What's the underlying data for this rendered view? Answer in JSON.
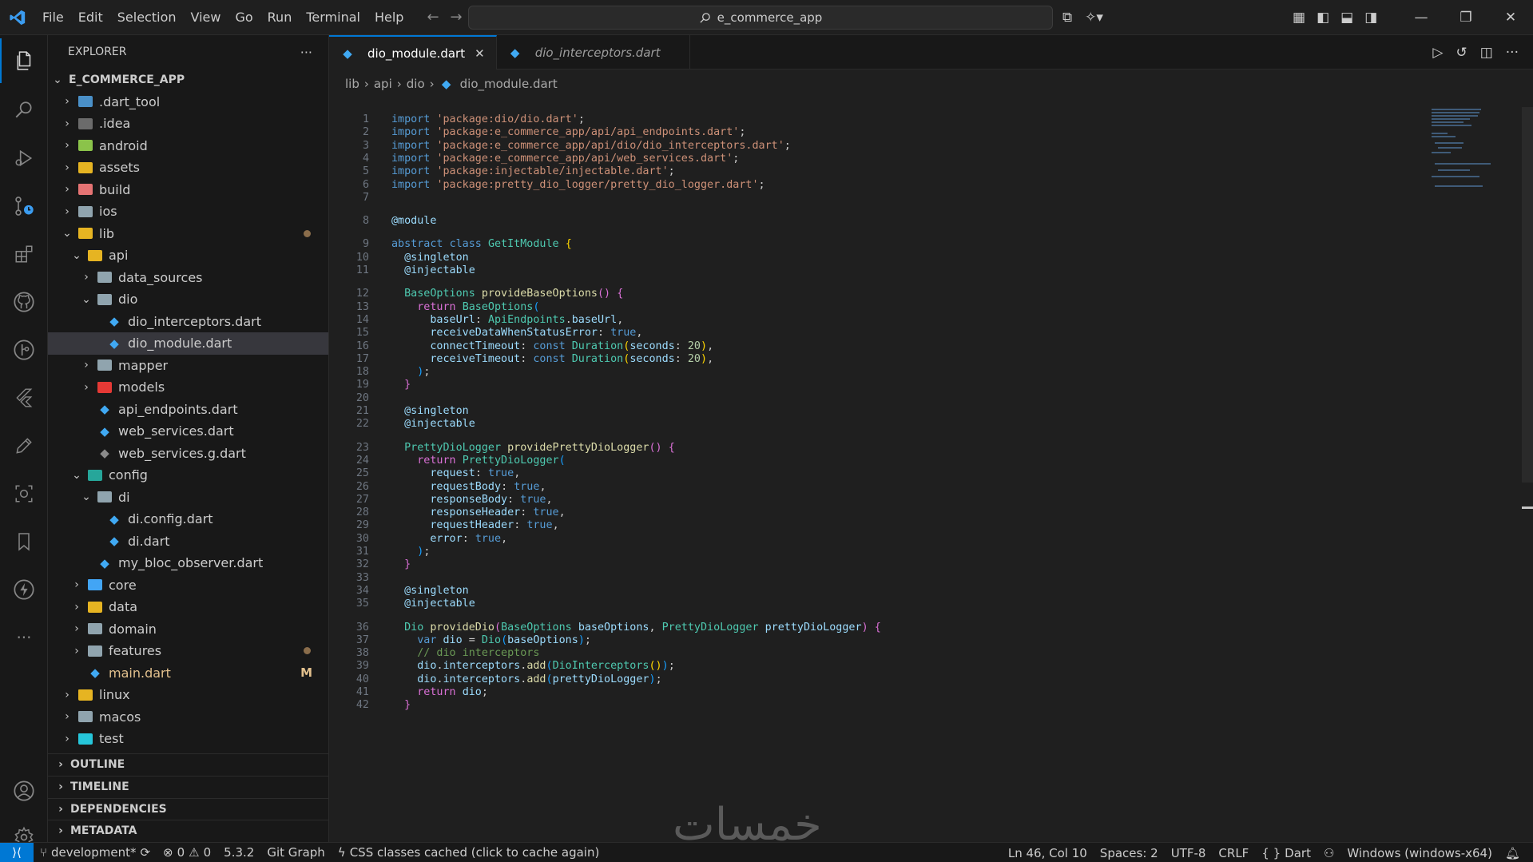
{
  "titlebar": {
    "menu": [
      "File",
      "Edit",
      "Selection",
      "View",
      "Go",
      "Run",
      "Terminal",
      "Help"
    ],
    "search_text": "e_commerce_app"
  },
  "sidebar": {
    "title": "EXPLORER",
    "more": "···",
    "root": "E_COMMERCE_APP",
    "tree": [
      {
        "label": ".dart_tool",
        "depth": 1,
        "type": "folder",
        "open": false,
        "color": "#4a90c8"
      },
      {
        "label": ".idea",
        "depth": 1,
        "type": "folder",
        "open": false,
        "color": "#6b6b6b"
      },
      {
        "label": "android",
        "depth": 1,
        "type": "folder",
        "open": false,
        "color": "#8bc34a"
      },
      {
        "label": "assets",
        "depth": 1,
        "type": "folder",
        "open": false,
        "color": "#e6b422"
      },
      {
        "label": "build",
        "depth": 1,
        "type": "folder",
        "open": false,
        "color": "#e57373"
      },
      {
        "label": "ios",
        "depth": 1,
        "type": "folder",
        "open": false,
        "color": "#90a4ae"
      },
      {
        "label": "lib",
        "depth": 1,
        "type": "folder",
        "open": true,
        "color": "#e6b422",
        "dot": true
      },
      {
        "label": "api",
        "depth": 2,
        "type": "folder",
        "open": true,
        "color": "#e6b422"
      },
      {
        "label": "data_sources",
        "depth": 3,
        "type": "folder",
        "open": false,
        "color": "#90a4ae"
      },
      {
        "label": "dio",
        "depth": 3,
        "type": "folder",
        "open": true,
        "color": "#90a4ae"
      },
      {
        "label": "dio_interceptors.dart",
        "depth": 4,
        "type": "dart"
      },
      {
        "label": "dio_module.dart",
        "depth": 4,
        "type": "dart",
        "selected": true
      },
      {
        "label": "mapper",
        "depth": 3,
        "type": "folder",
        "open": false,
        "color": "#90a4ae"
      },
      {
        "label": "models",
        "depth": 3,
        "type": "folder",
        "open": false,
        "color": "#e53935"
      },
      {
        "label": "api_endpoints.dart",
        "depth": 3,
        "type": "dart"
      },
      {
        "label": "web_services.dart",
        "depth": 3,
        "type": "dart"
      },
      {
        "label": "web_services.g.dart",
        "depth": 3,
        "type": "dart-gray"
      },
      {
        "label": "config",
        "depth": 2,
        "type": "folder",
        "open": true,
        "color": "#26a69a"
      },
      {
        "label": "di",
        "depth": 3,
        "type": "folder",
        "open": true,
        "color": "#90a4ae"
      },
      {
        "label": "di.config.dart",
        "depth": 4,
        "type": "dart"
      },
      {
        "label": "di.dart",
        "depth": 4,
        "type": "dart"
      },
      {
        "label": "my_bloc_observer.dart",
        "depth": 3,
        "type": "dart"
      },
      {
        "label": "core",
        "depth": 2,
        "type": "folder",
        "open": false,
        "color": "#42a5f5"
      },
      {
        "label": "data",
        "depth": 2,
        "type": "folder",
        "open": false,
        "color": "#e6b422"
      },
      {
        "label": "domain",
        "depth": 2,
        "type": "folder",
        "open": false,
        "color": "#90a4ae"
      },
      {
        "label": "features",
        "depth": 2,
        "type": "folder",
        "open": false,
        "color": "#90a4ae",
        "dot": true
      },
      {
        "label": "main.dart",
        "depth": 2,
        "type": "dart",
        "modified": true,
        "badge": "M"
      },
      {
        "label": "linux",
        "depth": 1,
        "type": "folder",
        "open": false,
        "color": "#e6b422"
      },
      {
        "label": "macos",
        "depth": 1,
        "type": "folder",
        "open": false,
        "color": "#90a4ae"
      },
      {
        "label": "test",
        "depth": 1,
        "type": "folder",
        "open": false,
        "color": "#26c6da"
      }
    ],
    "sections": [
      "OUTLINE",
      "TIMELINE",
      "DEPENDENCIES",
      "METADATA"
    ]
  },
  "editor": {
    "tabs": [
      {
        "label": "dio_module.dart",
        "active": true
      },
      {
        "label": "dio_interceptors.dart",
        "active": false
      }
    ],
    "breadcrumb": [
      "lib",
      "api",
      "dio",
      "dio_module.dart"
    ],
    "lines": [
      {
        "n": "1",
        "html": "<span class=\"kw\">import</span> <span class=\"str\">'package:dio/dio.dart'</span>;"
      },
      {
        "n": "2",
        "html": "<span class=\"kw\">import</span> <span class=\"str\">'package:e_commerce_app/api/api_endpoints.dart'</span>;"
      },
      {
        "n": "3",
        "html": "<span class=\"kw\">import</span> <span class=\"str\">'package:e_commerce_app/api/dio/dio_interceptors.dart'</span>;"
      },
      {
        "n": "4",
        "html": "<span class=\"kw\">import</span> <span class=\"str\">'package:e_commerce_app/api/web_services.dart'</span>;"
      },
      {
        "n": "5",
        "html": "<span class=\"kw\">import</span> <span class=\"str\">'package:injectable/injectable.dart'</span>;"
      },
      {
        "n": "6",
        "html": "<span class=\"kw\">import</span> <span class=\"str\">'package:pretty_dio_logger/pretty_dio_logger.dart'</span>;"
      },
      {
        "n": "7",
        "html": ""
      },
      {
        "n": "8",
        "html": "<span class=\"ann\">@module</span>"
      },
      {
        "n": "9",
        "html": "<span class=\"kw\">abstract</span> <span class=\"kw\">class</span> <span class=\"ty\">GetItModule</span> <span class=\"br1\">{</span>"
      },
      {
        "n": "10",
        "html": "  <span class=\"ann\">@singleton</span>"
      },
      {
        "n": "11",
        "html": "  <span class=\"ann\">@injectable</span>"
      },
      {
        "n": "12",
        "html": "  <span class=\"ty\">BaseOptions</span> <span class=\"fn\">provideBaseOptions</span><span class=\"br2\">()</span> <span class=\"br2\">{</span>"
      },
      {
        "n": "13",
        "html": "    <span class=\"br2\">return</span> <span class=\"ty\">BaseOptions</span><span class=\"br3\">(</span>"
      },
      {
        "n": "14",
        "html": "      <span class=\"var\">baseUrl</span>: <span class=\"ty\">ApiEndpoints</span>.<span class=\"var\">baseUrl</span>,"
      },
      {
        "n": "15",
        "html": "      <span class=\"var\">receiveDataWhenStatusError</span>: <span class=\"kw\">true</span>,"
      },
      {
        "n": "16",
        "html": "      <span class=\"var\">connectTimeout</span>: <span class=\"kw\">const</span> <span class=\"ty\">Duration</span><span class=\"br1\">(</span><span class=\"var\">seconds</span>: <span class=\"num\">20</span><span class=\"br1\">)</span>,"
      },
      {
        "n": "17",
        "html": "      <span class=\"var\">receiveTimeout</span>: <span class=\"kw\">const</span> <span class=\"ty\">Duration</span><span class=\"br1\">(</span><span class=\"var\">seconds</span>: <span class=\"num\">20</span><span class=\"br1\">)</span>,"
      },
      {
        "n": "18",
        "html": "    <span class=\"br3\">)</span>;"
      },
      {
        "n": "19",
        "html": "  <span class=\"br2\">}</span>"
      },
      {
        "n": "20",
        "html": ""
      },
      {
        "n": "21",
        "html": "  <span class=\"ann\">@singleton</span>"
      },
      {
        "n": "22",
        "html": "  <span class=\"ann\">@injectable</span>"
      },
      {
        "n": "23",
        "html": "  <span class=\"ty\">PrettyDioLogger</span> <span class=\"fn\">providePrettyDioLogger</span><span class=\"br2\">()</span> <span class=\"br2\">{</span>"
      },
      {
        "n": "24",
        "html": "    <span class=\"br2\">return</span> <span class=\"ty\">PrettyDioLogger</span><span class=\"br3\">(</span>"
      },
      {
        "n": "25",
        "html": "      <span class=\"var\">request</span>: <span class=\"kw\">true</span>,"
      },
      {
        "n": "26",
        "html": "      <span class=\"var\">requestBody</span>: <span class=\"kw\">true</span>,"
      },
      {
        "n": "27",
        "html": "      <span class=\"var\">responseBody</span>: <span class=\"kw\">true</span>,"
      },
      {
        "n": "28",
        "html": "      <span class=\"var\">responseHeader</span>: <span class=\"kw\">true</span>,"
      },
      {
        "n": "29",
        "html": "      <span class=\"var\">requestHeader</span>: <span class=\"kw\">true</span>,"
      },
      {
        "n": "30",
        "html": "      <span class=\"var\">error</span>: <span class=\"kw\">true</span>,"
      },
      {
        "n": "31",
        "html": "    <span class=\"br3\">)</span>;"
      },
      {
        "n": "32",
        "html": "  <span class=\"br2\">}</span>"
      },
      {
        "n": "33",
        "html": ""
      },
      {
        "n": "34",
        "html": "  <span class=\"ann\">@singleton</span>"
      },
      {
        "n": "35",
        "html": "  <span class=\"ann\">@injectable</span>"
      },
      {
        "n": "36",
        "html": "  <span class=\"ty\">Dio</span> <span class=\"fn\">provideDio</span><span class=\"br2\">(</span><span class=\"ty\">BaseOptions</span> <span class=\"var\">baseOptions</span>, <span class=\"ty\">PrettyDioLogger</span> <span class=\"var\">prettyDioLogger</span><span class=\"br2\">)</span> <span class=\"br2\">{</span>"
      },
      {
        "n": "37",
        "html": "    <span class=\"kw\">var</span> <span class=\"var\">dio</span> = <span class=\"ty\">Dio</span><span class=\"br3\">(</span><span class=\"var\">baseOptions</span><span class=\"br3\">)</span>;"
      },
      {
        "n": "38",
        "html": "    <span class=\"cmt\">// dio interceptors</span>"
      },
      {
        "n": "39",
        "html": "    <span class=\"var\">dio</span>.<span class=\"var\">interceptors</span>.<span class=\"fn\">add</span><span class=\"br3\">(</span><span class=\"ty\">DioInterceptors</span><span class=\"br1\">()</span><span class=\"br3\">)</span>;"
      },
      {
        "n": "40",
        "html": "    <span class=\"var\">dio</span>.<span class=\"var\">interceptors</span>.<span class=\"fn\">add</span><span class=\"br3\">(</span><span class=\"var\">prettyDioLogger</span><span class=\"br3\">)</span>;"
      },
      {
        "n": "41",
        "html": "    <span class=\"br2\">return</span> <span class=\"var\">dio</span>;"
      },
      {
        "n": "42",
        "html": "  <span class=\"br2\">}</span>"
      }
    ]
  },
  "watermark": "خمسات",
  "statusbar": {
    "branch": "development*",
    "errors": "0",
    "warnings": "0",
    "version": "5.3.2",
    "git_graph": "Git Graph",
    "css_cache": "CSS classes cached (click to cache again)",
    "cursor": "Ln 46, Col 10",
    "spaces": "Spaces: 2",
    "encoding": "UTF-8",
    "eol": "CRLF",
    "language": "Dart",
    "platform": "Windows (windows-x64)"
  },
  "colors": {
    "accent": "#0078d4",
    "background": "#1f1f1f",
    "sidebar": "#181818"
  }
}
